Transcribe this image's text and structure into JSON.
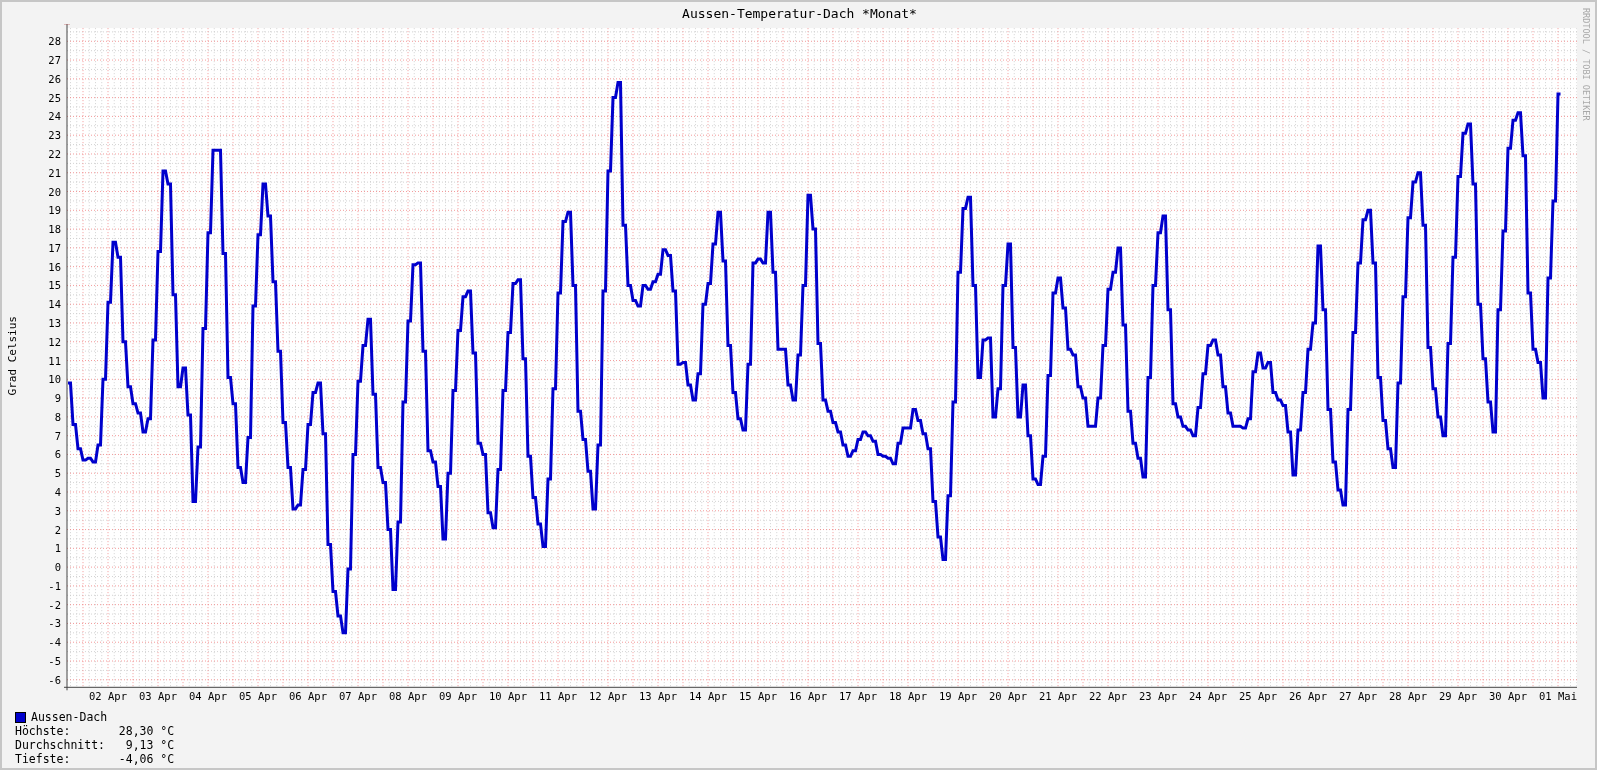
{
  "chart_data": {
    "type": "line",
    "grid": true,
    "title": "Aussen-Temperatur-Dach *Monat*",
    "ylabel": "Grad Celsius",
    "categories": [
      null,
      null,
      null,
      null,
      null,
      null,
      null,
      null,
      null,
      null,
      null,
      null,
      null,
      null,
      null,
      null,
      "02 Apr",
      null,
      null,
      null,
      null,
      null,
      null,
      null,
      null,
      null,
      null,
      null,
      null,
      null,
      null,
      null,
      null,
      null,
      null,
      null,
      "03 Apr",
      null,
      null,
      null,
      null,
      null,
      null,
      null,
      null,
      null,
      null,
      null,
      null,
      null,
      null,
      null,
      null,
      null,
      null,
      null,
      "04 Apr",
      null,
      null,
      null,
      null,
      null,
      null,
      null,
      null,
      null,
      null,
      null,
      null,
      null,
      null,
      null,
      null,
      null,
      null,
      null,
      "05 Apr",
      null,
      null,
      null,
      null,
      null,
      null,
      null,
      null,
      null,
      null,
      null,
      null,
      null,
      null,
      null,
      null,
      null,
      null,
      null,
      "06 Apr",
      null,
      null,
      null,
      null,
      null,
      null,
      null,
      null,
      null,
      null,
      null,
      null,
      null,
      null,
      null,
      null,
      null,
      null,
      null,
      "07 Apr",
      null,
      null,
      null,
      null,
      null,
      null,
      null,
      null,
      null,
      null,
      null,
      null,
      null,
      null,
      null,
      null,
      null,
      null,
      null,
      "08 Apr",
      null,
      null,
      null,
      null,
      null,
      null,
      null,
      null,
      null,
      null,
      null,
      null,
      null,
      null,
      null,
      null,
      null,
      null,
      null,
      "09 Apr",
      null,
      null,
      null,
      null,
      null,
      null,
      null,
      null,
      null,
      null,
      null,
      null,
      null,
      null,
      null,
      null,
      null,
      null,
      null,
      "10 Apr",
      null,
      null,
      null,
      null,
      null,
      null,
      null,
      null,
      null,
      null,
      null,
      null,
      null,
      null,
      null,
      null,
      null,
      null,
      null,
      "11 Apr",
      null,
      null,
      null,
      null,
      null,
      null,
      null,
      null,
      null,
      null,
      null,
      null,
      null,
      null,
      null,
      null,
      null,
      null,
      null,
      "12 Apr",
      null,
      null,
      null,
      null,
      null,
      null,
      null,
      null,
      null,
      null,
      null,
      null,
      null,
      null,
      null,
      null,
      null,
      null,
      null,
      "13 Apr",
      null,
      null,
      null,
      null,
      null,
      null,
      null,
      null,
      null,
      null,
      null,
      null,
      null,
      null,
      null,
      null,
      null,
      null,
      null,
      "14 Apr",
      null,
      null,
      null,
      null,
      null,
      null,
      null,
      null,
      null,
      null,
      null,
      null,
      null,
      null,
      null,
      null,
      null,
      null,
      null,
      "15 Apr",
      null,
      null,
      null,
      null,
      null,
      null,
      null,
      null,
      null,
      null,
      null,
      null,
      null,
      null,
      null,
      null,
      null,
      null,
      null,
      "16 Apr",
      null,
      null,
      null,
      null,
      null,
      null,
      null,
      null,
      null,
      null,
      null,
      null,
      null,
      null,
      null,
      null,
      null,
      null,
      null,
      "17 Apr",
      null,
      null,
      null,
      null,
      null,
      null,
      null,
      null,
      null,
      null,
      null,
      null,
      null,
      null,
      null,
      null,
      null,
      null,
      null,
      "18 Apr",
      null,
      null,
      null,
      null,
      null,
      null,
      null,
      null,
      null,
      null,
      null,
      null,
      null,
      null,
      null,
      null,
      null,
      null,
      null,
      "19 Apr",
      null,
      null,
      null,
      null,
      null,
      null,
      null,
      null,
      null,
      null,
      null,
      null,
      null,
      null,
      null,
      null,
      null,
      null,
      null,
      "20 Apr",
      null,
      null,
      null,
      null,
      null,
      null,
      null,
      null,
      null,
      null,
      null,
      null,
      null,
      null,
      null,
      null,
      null,
      null,
      null,
      "21 Apr",
      null,
      null,
      null,
      null,
      null,
      null,
      null,
      null,
      null,
      null,
      null,
      null,
      null,
      null,
      null,
      null,
      null,
      null,
      null,
      "22 Apr",
      null,
      null,
      null,
      null,
      null,
      null,
      null,
      null,
      null,
      null,
      null,
      null,
      null,
      null,
      null,
      null,
      null,
      null,
      null,
      "23 Apr",
      null,
      null,
      null,
      null,
      null,
      null,
      null,
      null,
      null,
      null,
      null,
      null,
      null,
      null,
      null,
      null,
      null,
      null,
      null,
      "24 Apr",
      null,
      null,
      null,
      null,
      null,
      null,
      null,
      null,
      null,
      null,
      null,
      null,
      null,
      null,
      null,
      null,
      null,
      null,
      null,
      "25 Apr",
      null,
      null,
      null,
      null,
      null,
      null,
      null,
      null,
      null,
      null,
      null,
      null,
      null,
      null,
      null,
      null,
      null,
      null,
      null,
      "26 Apr",
      null,
      null,
      null,
      null,
      null,
      null,
      null,
      null,
      null,
      null,
      null,
      null,
      null,
      null,
      null,
      null,
      null,
      null,
      null,
      "27 Apr",
      null,
      null,
      null,
      null,
      null,
      null,
      null,
      null,
      null,
      null,
      null,
      null,
      null,
      null,
      null,
      null,
      null,
      null,
      null,
      "28 Apr",
      null,
      null,
      null,
      null,
      null,
      null,
      null,
      null,
      null,
      null,
      null,
      null,
      null,
      null,
      null,
      null,
      null,
      null,
      null,
      "29 Apr",
      null,
      null,
      null,
      null,
      null,
      null,
      null,
      null,
      null,
      null,
      null,
      null,
      null,
      null,
      null,
      null,
      null,
      null,
      null,
      "30 Apr",
      null,
      null,
      null,
      null,
      null,
      null,
      null,
      null,
      null,
      null,
      null,
      null,
      null,
      null,
      null,
      null,
      null,
      null,
      null,
      "01 Mai",
      null
    ],
    "series": [
      {
        "name": "Aussen-Dach",
        "color": "#0000cc",
        "values": [
          9.8,
          9.8,
          7.6,
          7.6,
          6.3,
          6.3,
          5.7,
          5.7,
          5.8,
          5.8,
          5.6,
          5.6,
          6.5,
          6.5,
          10,
          10,
          14.1,
          14.1,
          17.3,
          17.3,
          16.5,
          16.5,
          12,
          12,
          9.6,
          9.6,
          8.7,
          8.7,
          8.2,
          8.2,
          7.2,
          7.2,
          7.9,
          7.9,
          12.1,
          12.1,
          16.8,
          16.8,
          21.1,
          21.1,
          20.4,
          20.4,
          14.5,
          14.5,
          9.6,
          9.6,
          10.6,
          10.6,
          8.1,
          8.1,
          3.5,
          3.5,
          6.4,
          6.4,
          12.7,
          12.7,
          17.8,
          17.8,
          22.2,
          22.2,
          22.2,
          22.2,
          16.7,
          16.7,
          10.1,
          10.1,
          8.7,
          8.7,
          5.3,
          5.3,
          4.5,
          4.5,
          6.9,
          6.9,
          13.9,
          13.9,
          17.7,
          17.7,
          20.4,
          20.4,
          18.7,
          18.7,
          15.2,
          15.2,
          11.5,
          11.5,
          7.7,
          7.7,
          5.3,
          5.3,
          3.1,
          3.1,
          3.3,
          3.3,
          5.2,
          5.2,
          7.6,
          7.6,
          9.3,
          9.3,
          9.8,
          9.8,
          7.1,
          7.1,
          1.2,
          1.2,
          -1.3,
          -1.3,
          -2.6,
          -2.6,
          -3.5,
          -3.5,
          -0.1,
          -0.1,
          6.0,
          6.0,
          9.9,
          9.9,
          11.8,
          11.8,
          13.2,
          13.2,
          9.2,
          9.2,
          5.3,
          5.3,
          4.5,
          4.5,
          2.0,
          2.0,
          -1.2,
          -1.2,
          2.4,
          2.4,
          8.8,
          8.8,
          13.1,
          13.1,
          16.1,
          16.1,
          16.2,
          16.2,
          11.5,
          11.5,
          6.2,
          6.2,
          5.6,
          5.6,
          4.3,
          4.3,
          1.5,
          1.5,
          5.0,
          5.0,
          9.4,
          9.4,
          12.6,
          12.6,
          14.4,
          14.4,
          14.7,
          14.7,
          11.4,
          11.4,
          6.6,
          6.6,
          6.0,
          6.0,
          2.9,
          2.9,
          2.1,
          2.1,
          5.2,
          5.2,
          9.4,
          9.4,
          12.5,
          12.5,
          15.1,
          15.1,
          15.3,
          15.3,
          11.1,
          11.1,
          5.9,
          5.9,
          3.7,
          3.7,
          2.3,
          2.3,
          1.1,
          1.1,
          4.7,
          4.7,
          9.5,
          9.5,
          14.6,
          14.6,
          18.4,
          18.4,
          18.9,
          18.9,
          15.0,
          15.0,
          8.3,
          8.3,
          6.8,
          6.8,
          5.1,
          5.1,
          3.1,
          3.1,
          6.5,
          6.5,
          14.7,
          14.7,
          21.1,
          21.1,
          25.0,
          25.0,
          25.8,
          25.8,
          18.2,
          18.2,
          15.0,
          15.0,
          14.2,
          14.2,
          13.9,
          13.9,
          15.0,
          15.0,
          14.8,
          14.8,
          15.2,
          15.2,
          15.6,
          15.6,
          16.9,
          16.9,
          16.6,
          16.6,
          14.7,
          14.7,
          10.8,
          10.8,
          10.9,
          10.9,
          9.7,
          9.7,
          8.9,
          8.9,
          10.3,
          10.3,
          14.0,
          14.0,
          15.1,
          15.1,
          17.2,
          17.2,
          18.9,
          18.9,
          16.3,
          16.3,
          11.8,
          11.8,
          9.3,
          9.3,
          7.9,
          7.9,
          7.3,
          7.3,
          10.8,
          10.8,
          16.2,
          16.2,
          16.4,
          16.4,
          16.2,
          16.2,
          18.9,
          18.9,
          15.7,
          15.7,
          11.6,
          11.6,
          11.6,
          11.6,
          9.7,
          9.7,
          8.9,
          8.9,
          11.3,
          11.3,
          15.0,
          15.0,
          19.8,
          19.8,
          18.0,
          18.0,
          11.9,
          11.9,
          8.9,
          8.9,
          8.3,
          8.3,
          7.7,
          7.7,
          7.2,
          7.2,
          6.5,
          6.5,
          5.9,
          5.9,
          6.2,
          6.2,
          6.8,
          6.8,
          7.2,
          7.2,
          7.0,
          7.0,
          6.7,
          6.7,
          6.0,
          6.0,
          5.9,
          5.9,
          5.8,
          5.8,
          5.5,
          5.5,
          6.6,
          6.6,
          7.4,
          7.4,
          7.4,
          7.4,
          8.4,
          8.4,
          7.8,
          7.8,
          7.1,
          7.1,
          6.3,
          6.3,
          3.5,
          3.5,
          1.6,
          1.6,
          0.4,
          0.4,
          3.8,
          3.8,
          8.8,
          8.8,
          15.7,
          15.7,
          19.1,
          19.1,
          19.7,
          19.7,
          15.0,
          15.0,
          10.1,
          10.1,
          12.1,
          12.1,
          12.2,
          12.2,
          8.0,
          8.0,
          9.5,
          9.5,
          15.0,
          15.0,
          17.2,
          17.2,
          11.7,
          11.7,
          8.0,
          8.0,
          9.7,
          9.7,
          7.0,
          7.0,
          4.7,
          4.7,
          4.4,
          4.4,
          5.9,
          5.9,
          10.2,
          10.2,
          14.6,
          14.6,
          15.4,
          15.4,
          13.8,
          13.8,
          11.6,
          11.6,
          11.3,
          11.3,
          9.6,
          9.6,
          9.0,
          9.0,
          7.5,
          7.5,
          7.5,
          7.5,
          9.0,
          9.0,
          11.8,
          11.8,
          14.8,
          14.8,
          15.7,
          15.7,
          17.0,
          17.0,
          12.9,
          12.9,
          8.3,
          8.3,
          6.6,
          6.6,
          5.8,
          5.8,
          4.8,
          4.8,
          10.1,
          10.1,
          15.0,
          15.0,
          17.8,
          17.8,
          18.7,
          18.7,
          13.7,
          13.7,
          8.7,
          8.7,
          8.0,
          8.0,
          7.5,
          7.5,
          7.3,
          7.3,
          7.0,
          7.0,
          8.5,
          8.5,
          10.3,
          10.3,
          11.8,
          11.8,
          12.1,
          12.1,
          11.3,
          11.3,
          9.6,
          9.6,
          8.2,
          8.2,
          7.5,
          7.5,
          7.5,
          7.5,
          7.4,
          7.4,
          7.9,
          7.9,
          10.4,
          10.4,
          11.4,
          11.4,
          10.6,
          10.6,
          10.9,
          10.9,
          9.3,
          9.3,
          8.9,
          8.9,
          8.6,
          8.6,
          7.2,
          7.2,
          4.9,
          4.9,
          7.3,
          7.3,
          9.3,
          9.3,
          11.6,
          11.6,
          13.0,
          13.0,
          17.1,
          17.1,
          13.7,
          13.7,
          8.4,
          8.4,
          5.6,
          5.6,
          4.1,
          4.1,
          3.3,
          3.3,
          8.4,
          8.4,
          12.5,
          12.5,
          16.2,
          16.2,
          18.5,
          18.5,
          19.0,
          19.0,
          16.2,
          16.2,
          10.1,
          10.1,
          7.8,
          7.8,
          6.3,
          6.3,
          5.3,
          5.3,
          9.8,
          9.8,
          14.4,
          14.4,
          18.6,
          18.6,
          20.5,
          20.5,
          21.0,
          21.0,
          18.2,
          18.2,
          11.7,
          11.7,
          9.5,
          9.5,
          8.0,
          8.0,
          7.0,
          7.0,
          11.9,
          11.9,
          16.5,
          16.5,
          20.8,
          20.8,
          23.1,
          23.1,
          23.6,
          23.6,
          20.4,
          20.4,
          14.0,
          14.0,
          11.1,
          11.1,
          8.8,
          8.8,
          7.2,
          7.2,
          13.7,
          13.7,
          17.9,
          17.9,
          22.3,
          22.3,
          23.8,
          23.8,
          24.2,
          24.2,
          21.9,
          21.9,
          14.6,
          14.6,
          11.6,
          11.6,
          10.9,
          10.9,
          9.0,
          9.0,
          15.4,
          15.4,
          19.5,
          19.5,
          25.2,
          25.2
        ]
      }
    ],
    "ylim": [
      -6.4,
      28.7
    ],
    "yticks": [
      -6,
      -5,
      -4,
      -3,
      -2,
      -1,
      0,
      1,
      2,
      3,
      4,
      5,
      6,
      7,
      8,
      9,
      10,
      11,
      12,
      13,
      14,
      15,
      16,
      17,
      18,
      19,
      20,
      21,
      22,
      23,
      24,
      25,
      26,
      27,
      28
    ]
  },
  "credit": "RRDTOOL / TOBI OETIKER",
  "stats": [
    {
      "label": "Höchste:",
      "value": "28,30 °C"
    },
    {
      "label": "Durchschnitt:",
      "value": "9,13 °C"
    },
    {
      "label": "Tiefste:",
      "value": "-4,06 °C"
    }
  ]
}
